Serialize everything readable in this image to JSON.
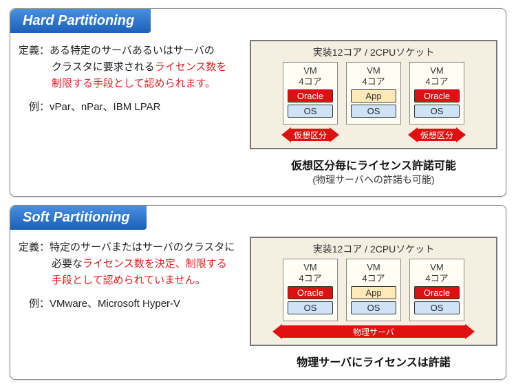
{
  "hard": {
    "title": "Hard Partitioning",
    "def_prefix": "定義：ある特定のサーバあるいはサーバの",
    "def_line2a": "クラスタに要求される",
    "def_line2b": "ライセンス数を",
    "def_line3": "制限する手段として認められます。",
    "example": "例：vPar、nPar、IBM LPAR",
    "server_title": "実装12コア / 2CPUソケット",
    "vm_label_l1": "VM",
    "vm_label_l2": "4コア",
    "oracle": "Oracle",
    "app": "App",
    "os": "OS",
    "arrow_label": "仮想区分",
    "caption_main": "仮想区分毎にライセンス許諾可能",
    "caption_sub": "(物理サーバへの許諾も可能)"
  },
  "soft": {
    "title": "Soft Partitioning",
    "def_prefix": "定義：特定のサーバまたはサーバのクラスタに",
    "def_line2a": "必要な",
    "def_line2b": "ライセンス数を決定、制限する",
    "def_line3": "手段として認められていません。",
    "example": "例：VMware、Microsoft Hyper-V",
    "server_title": "実装12コア / 2CPUソケット",
    "vm_label_l1": "VM",
    "vm_label_l2": "4コア",
    "oracle": "Oracle",
    "app": "App",
    "os": "OS",
    "arrow_label": "物理サーバ",
    "caption_main": "物理サーバにライセンスは許諾"
  }
}
